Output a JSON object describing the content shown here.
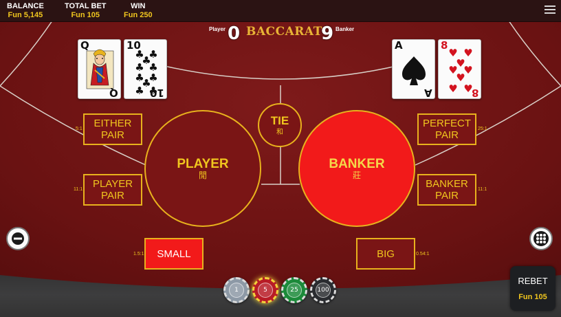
{
  "topbar": {
    "balance": {
      "label": "BALANCE",
      "value": "Fun 5,145"
    },
    "total_bet": {
      "label": "TOTAL BET",
      "value": "Fun 105"
    },
    "win": {
      "label": "WIN",
      "value": "Fun 250"
    }
  },
  "scoreboard": {
    "title": "BACCARAT",
    "player_label": "Player",
    "player_score": "0",
    "banker_label": "Banker",
    "banker_score": "9"
  },
  "cards": {
    "player": [
      {
        "rank": "Q",
        "suit": "clubs",
        "suit_symbol": "♣",
        "color": "black"
      },
      {
        "rank": "10",
        "suit": "clubs",
        "suit_symbol": "♣",
        "color": "black"
      }
    ],
    "banker": [
      {
        "rank": "A",
        "suit": "spades",
        "suit_symbol": "♠",
        "color": "black"
      },
      {
        "rank": "8",
        "suit": "hearts",
        "suit_symbol": "♥",
        "color": "red"
      }
    ]
  },
  "bets": {
    "either_pair": {
      "line1": "EITHER",
      "line2": "PAIR",
      "payout": "5:1"
    },
    "player_pair": {
      "line1": "PLAYER",
      "line2": "PAIR",
      "payout": "11:1"
    },
    "perfect_pair": {
      "line1": "PERFECT",
      "line2": "PAIR",
      "payout": "25:1"
    },
    "banker_pair": {
      "line1": "BANKER",
      "line2": "PAIR",
      "payout": "11:1"
    },
    "tie": {
      "label": "TIE",
      "chinese": "和"
    },
    "player": {
      "label": "PLAYER",
      "chinese": "閒"
    },
    "banker": {
      "label": "BANKER",
      "chinese": "莊"
    },
    "small": {
      "label": "SMALL",
      "payout": "1.5:1"
    },
    "big": {
      "label": "BIG",
      "payout": "0.54:1"
    }
  },
  "chips": [
    {
      "value": "1",
      "color": "#8d99a6"
    },
    {
      "value": "5",
      "color": "#b81c26"
    },
    {
      "value": "25",
      "color": "#1c8a3a"
    },
    {
      "value": "100",
      "color": "#2a2c30"
    }
  ],
  "rebet": {
    "label": "REBET",
    "amount": "Fun 105"
  },
  "colors": {
    "gold": "#f0c61e",
    "table_red": "#7a1515",
    "banker_red": "#f21a1a"
  },
  "icons": {
    "menu": "hamburger-menu-icon",
    "zoom_out": "minus-icon",
    "roadmap": "grid-dots-icon"
  }
}
